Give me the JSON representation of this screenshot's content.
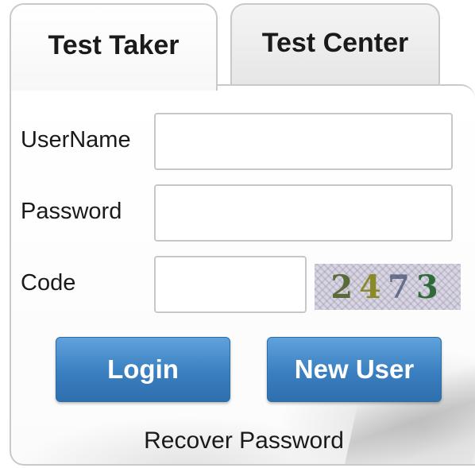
{
  "tabs": [
    {
      "label": "Test Taker",
      "active": true
    },
    {
      "label": "Test Center",
      "active": false
    }
  ],
  "form": {
    "username_label": "UserName",
    "username_value": "",
    "password_label": "Password",
    "password_value": "",
    "code_label": "Code",
    "code_value": "",
    "captcha_digits": [
      "2",
      "4",
      "7",
      "3"
    ]
  },
  "buttons": {
    "login_label": "Login",
    "new_user_label": "New User"
  },
  "recover_label": "Recover Password",
  "colors": {
    "button": "#3a7fc0",
    "border": "#c9c9c9"
  }
}
